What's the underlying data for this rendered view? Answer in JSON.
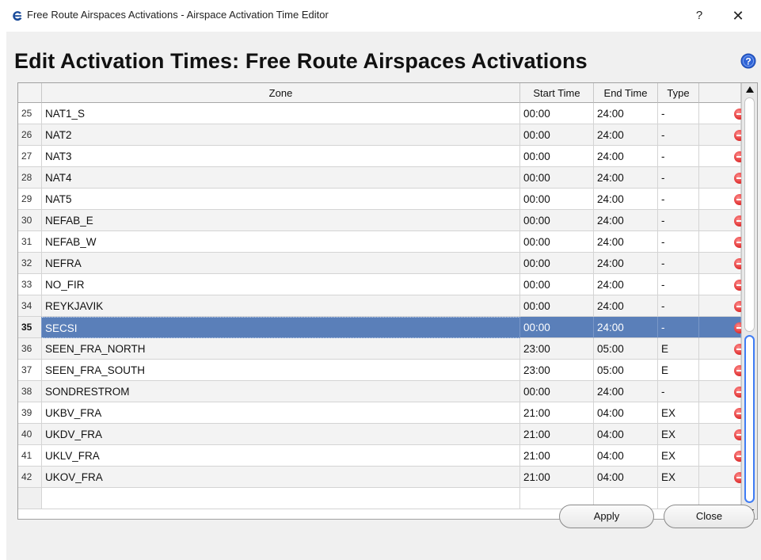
{
  "window": {
    "title": "Free Route Airspaces Activations - Airspace Activation Time Editor",
    "help_label": "?",
    "close_label": "✕"
  },
  "dialog": {
    "heading": "Edit Activation Times: Free Route Airspaces Activations"
  },
  "table": {
    "columns": {
      "zone": "Zone",
      "start": "Start Time",
      "end": "End Time",
      "type": "Type"
    },
    "sort_indicator": "▲",
    "rows": [
      {
        "num": "25",
        "zone": "NAT1_S",
        "start": "00:00",
        "end": "24:00",
        "type": "-"
      },
      {
        "num": "26",
        "zone": "NAT2",
        "start": "00:00",
        "end": "24:00",
        "type": "-"
      },
      {
        "num": "27",
        "zone": "NAT3",
        "start": "00:00",
        "end": "24:00",
        "type": "-"
      },
      {
        "num": "28",
        "zone": "NAT4",
        "start": "00:00",
        "end": "24:00",
        "type": "-"
      },
      {
        "num": "29",
        "zone": "NAT5",
        "start": "00:00",
        "end": "24:00",
        "type": "-"
      },
      {
        "num": "30",
        "zone": "NEFAB_E",
        "start": "00:00",
        "end": "24:00",
        "type": "-"
      },
      {
        "num": "31",
        "zone": "NEFAB_W",
        "start": "00:00",
        "end": "24:00",
        "type": "-"
      },
      {
        "num": "32",
        "zone": "NEFRA",
        "start": "00:00",
        "end": "24:00",
        "type": "-"
      },
      {
        "num": "33",
        "zone": "NO_FIR",
        "start": "00:00",
        "end": "24:00",
        "type": "-"
      },
      {
        "num": "34",
        "zone": "REYKJAVIK",
        "start": "00:00",
        "end": "24:00",
        "type": "-"
      },
      {
        "num": "35",
        "zone": "SECSI",
        "start": "00:00",
        "end": "24:00",
        "type": "-",
        "selected": true
      },
      {
        "num": "36",
        "zone": "SEEN_FRA_NORTH",
        "start": "23:00",
        "end": "05:00",
        "type": "E"
      },
      {
        "num": "37",
        "zone": "SEEN_FRA_SOUTH",
        "start": "23:00",
        "end": "05:00",
        "type": "E"
      },
      {
        "num": "38",
        "zone": "SONDRESTROM",
        "start": "00:00",
        "end": "24:00",
        "type": "-"
      },
      {
        "num": "39",
        "zone": "UKBV_FRA",
        "start": "21:00",
        "end": "04:00",
        "type": "EX"
      },
      {
        "num": "40",
        "zone": "UKDV_FRA",
        "start": "21:00",
        "end": "04:00",
        "type": "EX"
      },
      {
        "num": "41",
        "zone": "UKLV_FRA",
        "start": "21:00",
        "end": "04:00",
        "type": "EX"
      },
      {
        "num": "42",
        "zone": "UKOV_FRA",
        "start": "21:00",
        "end": "04:00",
        "type": "EX"
      }
    ]
  },
  "buttons": {
    "apply": "Apply",
    "close": "Close"
  },
  "colors": {
    "selection": "#5a7fb9",
    "delete": "#e33a3a",
    "add": "#3aa83a",
    "scroll_thumb": "#3f7cf4"
  },
  "icons": {
    "app": "app-logo-icon",
    "help": "help-circle-icon",
    "delete": "remove-circle-icon",
    "add": "add-circle-icon"
  }
}
